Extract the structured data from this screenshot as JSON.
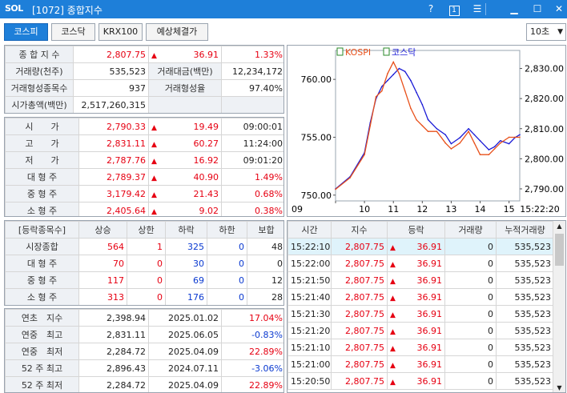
{
  "window": {
    "logo": "SOL",
    "title": "[1072] 종합지수"
  },
  "tabs": [
    "코스피",
    "코스닥",
    "KRX100",
    "예상체결가"
  ],
  "interval": "10초",
  "summary": {
    "rows": [
      [
        "종 합 지 수",
        "2,807.75",
        "▲",
        "36.91",
        "1.33%"
      ],
      [
        "거래량(천주)",
        "535,523",
        "거래대금(백만)",
        "12,234,172"
      ],
      [
        "거래형성종목수",
        "937",
        "거래형성율",
        "97.40%"
      ],
      [
        "시가총액(백만)",
        "2,517,260,315"
      ]
    ]
  },
  "ohlc": [
    [
      "시　　가",
      "2,790.33",
      "▲",
      "19.49",
      "09:00:01"
    ],
    [
      "고　　가",
      "2,831.11",
      "▲",
      "60.27",
      "11:24:00"
    ],
    [
      "저　　가",
      "2,787.76",
      "▲",
      "16.92",
      "09:01:20"
    ],
    [
      "대 형 주",
      "2,789.37",
      "▲",
      "40.90",
      "1.49%"
    ],
    [
      "중 형 주",
      "3,179.42",
      "▲",
      "21.43",
      "0.68%"
    ],
    [
      "소 형 주",
      "2,405.64",
      "▲",
      "9.02",
      "0.38%"
    ]
  ],
  "breadth": {
    "headers": [
      "[등락종목수]",
      "상승",
      "상한",
      "하락",
      "하한",
      "보합"
    ],
    "rows": [
      [
        "시장종합",
        "564",
        "1",
        "325",
        "0",
        "48"
      ],
      [
        "대 형 주",
        "70",
        "0",
        "30",
        "0",
        "0"
      ],
      [
        "중 형 주",
        "117",
        "0",
        "69",
        "0",
        "12"
      ],
      [
        "소 형 주",
        "313",
        "0",
        "176",
        "0",
        "28"
      ]
    ]
  },
  "yearly": [
    [
      "연초　지수",
      "2,398.94",
      "2025.01.02",
      "17.04%"
    ],
    [
      "연중　최고",
      "2,831.11",
      "2025.06.05",
      "-0.83%"
    ],
    [
      "연중　최저",
      "2,284.72",
      "2025.04.09",
      "22.89%"
    ],
    [
      "52 주 최고",
      "2,896.43",
      "2024.07.11",
      "-3.06%"
    ],
    [
      "52 주 최저",
      "2,284.72",
      "2025.04.09",
      "22.89%"
    ]
  ],
  "ticks": {
    "headers": [
      "시간",
      "지수",
      "등락",
      "거래량",
      "누적거래량"
    ],
    "rows": [
      [
        "15:22:10",
        "2,807.75",
        "▲",
        "36.91",
        "0",
        "535,523"
      ],
      [
        "15:22:00",
        "2,807.75",
        "▲",
        "36.91",
        "0",
        "535,523"
      ],
      [
        "15:21:50",
        "2,807.75",
        "▲",
        "36.91",
        "0",
        "535,523"
      ],
      [
        "15:21:40",
        "2,807.75",
        "▲",
        "36.91",
        "0",
        "535,523"
      ],
      [
        "15:21:30",
        "2,807.75",
        "▲",
        "36.91",
        "0",
        "535,523"
      ],
      [
        "15:21:20",
        "2,807.75",
        "▲",
        "36.91",
        "0",
        "535,523"
      ],
      [
        "15:21:10",
        "2,807.75",
        "▲",
        "36.91",
        "0",
        "535,523"
      ],
      [
        "15:21:00",
        "2,807.75",
        "▲",
        "36.91",
        "0",
        "535,523"
      ],
      [
        "15:20:50",
        "2,807.75",
        "▲",
        "36.91",
        "0",
        "535,523"
      ]
    ]
  },
  "chart_data": {
    "type": "line",
    "legend": [
      "KOSPI",
      "코스닥"
    ],
    "x_ticks": [
      "09",
      "10",
      "11",
      "12",
      "13",
      "14",
      "15",
      "15:22:20"
    ],
    "left_ticks": [
      "760.00",
      "755.00",
      "750.00"
    ],
    "right_ticks": [
      "2,830.00",
      "2,820.00",
      "2,810.00",
      "2,800.00",
      "2,790.00"
    ],
    "left_range": [
      749.5,
      762.5
    ],
    "right_range": [
      2786,
      2836
    ],
    "colors": {
      "kospi": "#1a1ad6",
      "kosdaq": "#e8501a"
    },
    "series": [
      {
        "name": "KOSPI",
        "axis": "right",
        "x": [
          9.0,
          9.5,
          10.0,
          10.2,
          10.4,
          10.6,
          10.8,
          11.0,
          11.2,
          11.4,
          11.6,
          11.8,
          12.0,
          12.2,
          12.5,
          12.8,
          13.0,
          13.3,
          13.6,
          13.8,
          14.0,
          14.3,
          14.5,
          14.7,
          15.0,
          15.2,
          15.37
        ],
        "values": [
          2790,
          2794,
          2802,
          2812,
          2820,
          2824,
          2826,
          2828,
          2830,
          2829,
          2826,
          2822,
          2818,
          2813,
          2810,
          2808,
          2805,
          2807,
          2810,
          2808,
          2806,
          2803,
          2804,
          2806,
          2805,
          2807,
          2808
        ]
      },
      {
        "name": "코스닥",
        "axis": "left",
        "x": [
          9.0,
          9.5,
          10.0,
          10.2,
          10.4,
          10.6,
          10.8,
          11.0,
          11.2,
          11.4,
          11.6,
          11.8,
          12.0,
          12.2,
          12.5,
          12.8,
          13.0,
          13.3,
          13.6,
          13.8,
          14.0,
          14.3,
          14.5,
          14.7,
          15.0,
          15.2,
          15.37
        ],
        "values": [
          750.5,
          751.5,
          753.5,
          756.0,
          758.5,
          759.0,
          760.5,
          761.5,
          760.5,
          759.0,
          757.5,
          756.5,
          756.0,
          755.5,
          755.5,
          754.5,
          754.0,
          754.5,
          755.5,
          754.5,
          753.5,
          753.5,
          754.0,
          754.5,
          755.0,
          755.0,
          755.0
        ]
      }
    ]
  }
}
